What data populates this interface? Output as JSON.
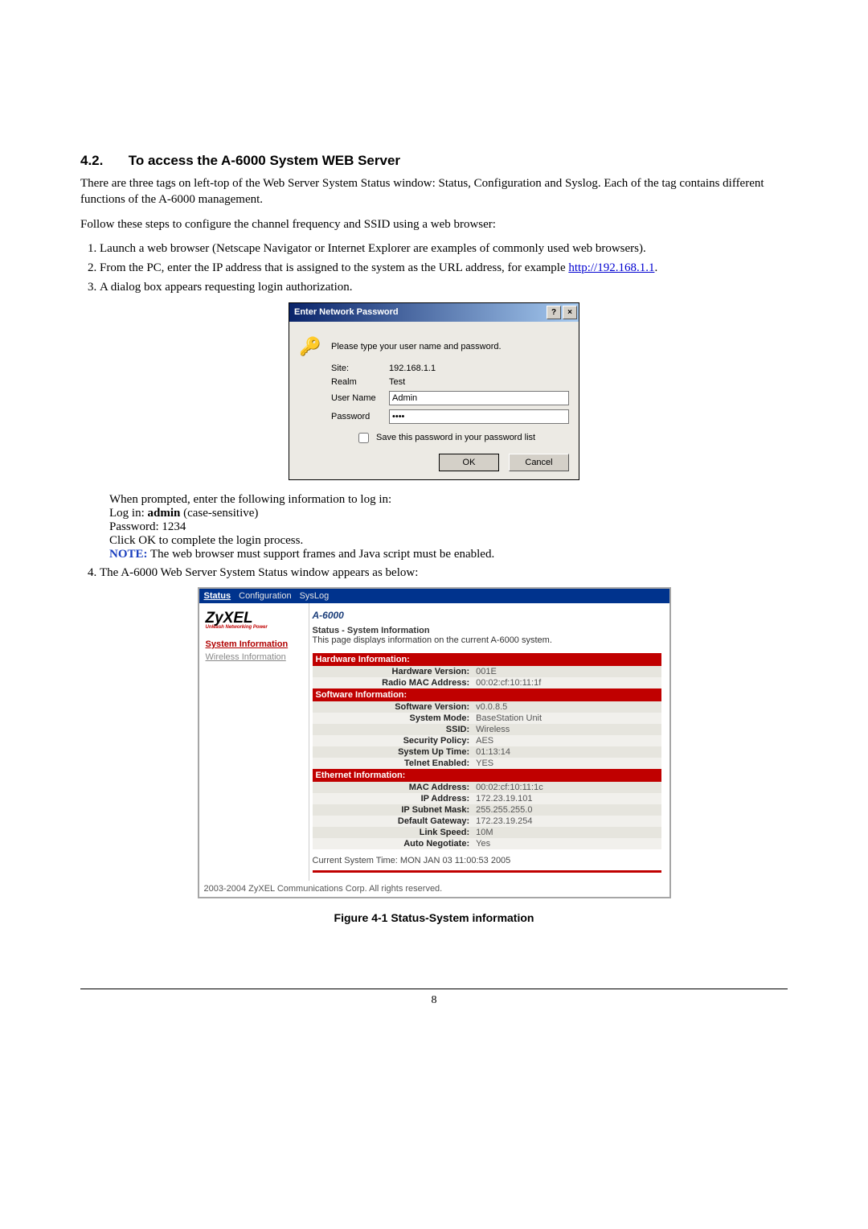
{
  "heading": {
    "number": "4.2.",
    "title": "To access the A-6000 System WEB Server"
  },
  "intro1": "There are three tags on left-top of the Web Server System Status window: Status, Configuration and Syslog. Each of the tag contains different functions of the A-6000 management.",
  "intro2": "Follow these steps to configure the channel frequency and SSID using a web browser:",
  "steps": {
    "s1": "Launch a web browser (Netscape Navigator or Internet Explorer are examples of commonly used web browsers).",
    "s2a": "From the PC, enter the IP address that is assigned to the system as the URL address, for example ",
    "s2link": "http://192.168.1.1",
    "s2b": ".",
    "s3": "A dialog box appears requesting login authorization.",
    "block": {
      "l1": "When prompted, enter the following information to log in:",
      "l2_label": " Log in: ",
      "l2_value": "admin",
      "l2_tail": " (case-sensitive)",
      "l3": " Password: 1234",
      "l4": " Click OK to complete the login process.",
      "note_label": "NOTE:",
      "note_text": " The web browser must support frames and Java script must be enabled."
    },
    "s4": "The A-6000 Web Server System Status window appears as below:"
  },
  "dialog": {
    "title": "Enter Network Password",
    "help_glyph": "?",
    "close_glyph": "×",
    "prompt": "Please type your user name and password.",
    "icon_glyph": "🔑",
    "site_label": "Site:",
    "site_value": "192.168.1.1",
    "realm_label": "Realm",
    "realm_value": "Test",
    "user_label": "User Name",
    "user_value": "Admin",
    "pass_label": "Password",
    "pass_value": "••••",
    "save_label": "Save this password in your password list",
    "ok": "OK",
    "cancel": "Cancel"
  },
  "webshot": {
    "tabs": {
      "t1": "Status",
      "t2": "Configuration",
      "t3": "SysLog"
    },
    "brand": "ZyXEL",
    "brand_sub": "Unleash Networking Power",
    "nav1": "System Information",
    "nav2": "Wireless Information",
    "model": "A-6000",
    "status_title": "Status - System Information",
    "status_desc": "This page displays information on the current A-6000 system.",
    "hw_hdr": "Hardware Information:",
    "sw_hdr": "Software Information:",
    "eth_hdr": "Ethernet Information:",
    "hw": {
      "version_k": "Hardware Version:",
      "version_v": "001E",
      "mac_k": "Radio MAC Address:",
      "mac_v": "00:02:cf:10:11:1f"
    },
    "sw": {
      "version_k": "Software Version:",
      "version_v": "v0.0.8.5",
      "mode_k": "System Mode:",
      "mode_v": "BaseStation Unit",
      "ssid_k": "SSID:",
      "ssid_v": "Wireless",
      "sec_k": "Security Policy:",
      "sec_v": "AES",
      "up_k": "System Up Time:",
      "up_v": "01:13:14",
      "telnet_k": "Telnet Enabled:",
      "telnet_v": "YES"
    },
    "eth": {
      "mac_k": "MAC Address:",
      "mac_v": "00:02:cf:10:11:1c",
      "ip_k": "IP Address:",
      "ip_v": "172.23.19.101",
      "mask_k": "IP Subnet Mask:",
      "mask_v": "255.255.255.0",
      "gw_k": "Default Gateway:",
      "gw_v": "172.23.19.254",
      "link_k": "Link Speed:",
      "link_v": "10M",
      "auto_k": "Auto Negotiate:",
      "auto_v": "Yes"
    },
    "cur_time": "Current System Time: MON JAN 03 11:00:53 2005",
    "copyright": "2003-2004 ZyXEL Communications Corp.  All rights reserved."
  },
  "caption": "Figure 4-1 Status-System information",
  "page_number": "8"
}
